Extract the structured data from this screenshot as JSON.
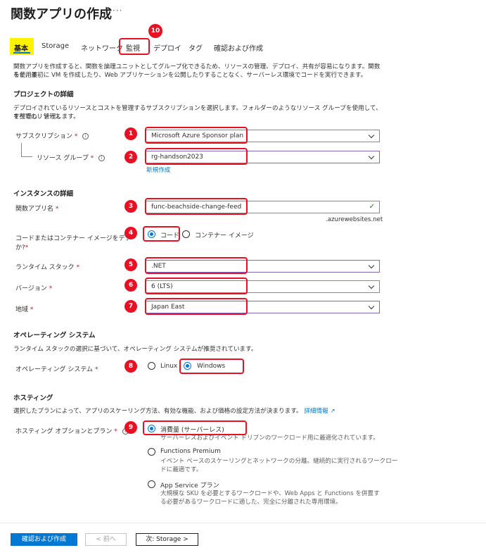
{
  "page": {
    "title": "関数アプリの作成",
    "more_icon": "ellipsis-icon",
    "more_glyph": "···"
  },
  "tabs": [
    {
      "label": "基本",
      "active": true
    },
    {
      "label": "Storage"
    },
    {
      "label": "ネットワーク"
    },
    {
      "label": "監視"
    },
    {
      "label": "デプロイ"
    },
    {
      "label": "タグ"
    },
    {
      "label": "確認および作成"
    }
  ],
  "intro": {
    "line1": "関数アプリを作成すると、関数を論理ユニットとしてグループ化できるため、リソースの管理、デプロイ、共有が容易になります。関数を使用す",
    "line2": "ると、最初に VM を作成したり、Web アプリケーションを公開したりすることなく、サーバーレス環境でコードを実行できます。"
  },
  "project": {
    "heading": "プロジェクトの詳細",
    "desc1": "デプロイされているリソースとコストを管理するサブスクリプションを選択します。フォルダーのようなリソース グループを使用して、すべてのリソース",
    "desc2": "を整理し、管理します。",
    "subscription_label": "サブスクリプション",
    "subscription_value": "Microsoft Azure Sponsor plan",
    "resource_group_label": "リソース グループ",
    "resource_group_value": "rg-handson2023",
    "new_link": "新規作成"
  },
  "instance": {
    "heading": "インスタンスの詳細",
    "app_name_label": "関数アプリ名",
    "app_name_value": "func-beachside-change-feed",
    "domain_suffix": ".azurewebsites.net",
    "deploy_label_1": "コードまたはコンテナー イメージをデプロイしますか",
    "deploy_label_2": "か?",
    "deploy_option_code": "コード",
    "deploy_option_container": "コンテナー イメージ",
    "runtime_label": "ランタイム スタック",
    "runtime_value": ".NET",
    "version_label": "バージョン",
    "version_value": "6 (LTS)",
    "region_label": "地域",
    "region_value": "Japan East"
  },
  "os": {
    "heading": "オペレーティング システム",
    "desc": "ランタイム スタックの選択に基づいて、オペレーティング システムが推奨されています。",
    "label": "オペレーティング システム",
    "option_linux": "Linux",
    "option_windows": "Windows"
  },
  "hosting": {
    "heading": "ホスティング",
    "desc": "選択したプランによって、アプリのスケーリング方法、有効な機能、および価格の設定方法が決まります。",
    "detail_link": "詳細情報",
    "label": "ホスティング オプションとプラン",
    "plans": [
      {
        "title": "消費量 (サーバーレス)",
        "desc1": "サーバーレスおよびイベント ドリブンのワークロード用に最適化されています。",
        "desc2": ""
      },
      {
        "title": "Functions Premium",
        "desc1": "イベント ベースのスケーリングとネットワークの分離。継続的に実行されるワークロー",
        "desc2": "ドに最適です。"
      },
      {
        "title": "App Service プラン",
        "desc1": "大規模な SKU を必要とするワークロードや、Web Apps と Functions を併置す",
        "desc2": "る必要があるワークロードに適した、完全に分離された専用環境。"
      }
    ]
  },
  "footer": {
    "review_button": "確認および作成",
    "prev_button": "< 前へ",
    "next_button": "次: Storage >"
  },
  "required_mark": "*",
  "info_glyph": "i",
  "external_glyph": "↗",
  "check_glyph": "✓",
  "badges": [
    "1",
    "2",
    "3",
    "4",
    "5",
    "6",
    "7",
    "8",
    "9",
    "10"
  ],
  "colors": {
    "accent": "#0078d4",
    "highlight": "#e81123",
    "tab_highlight": "#fff200"
  }
}
